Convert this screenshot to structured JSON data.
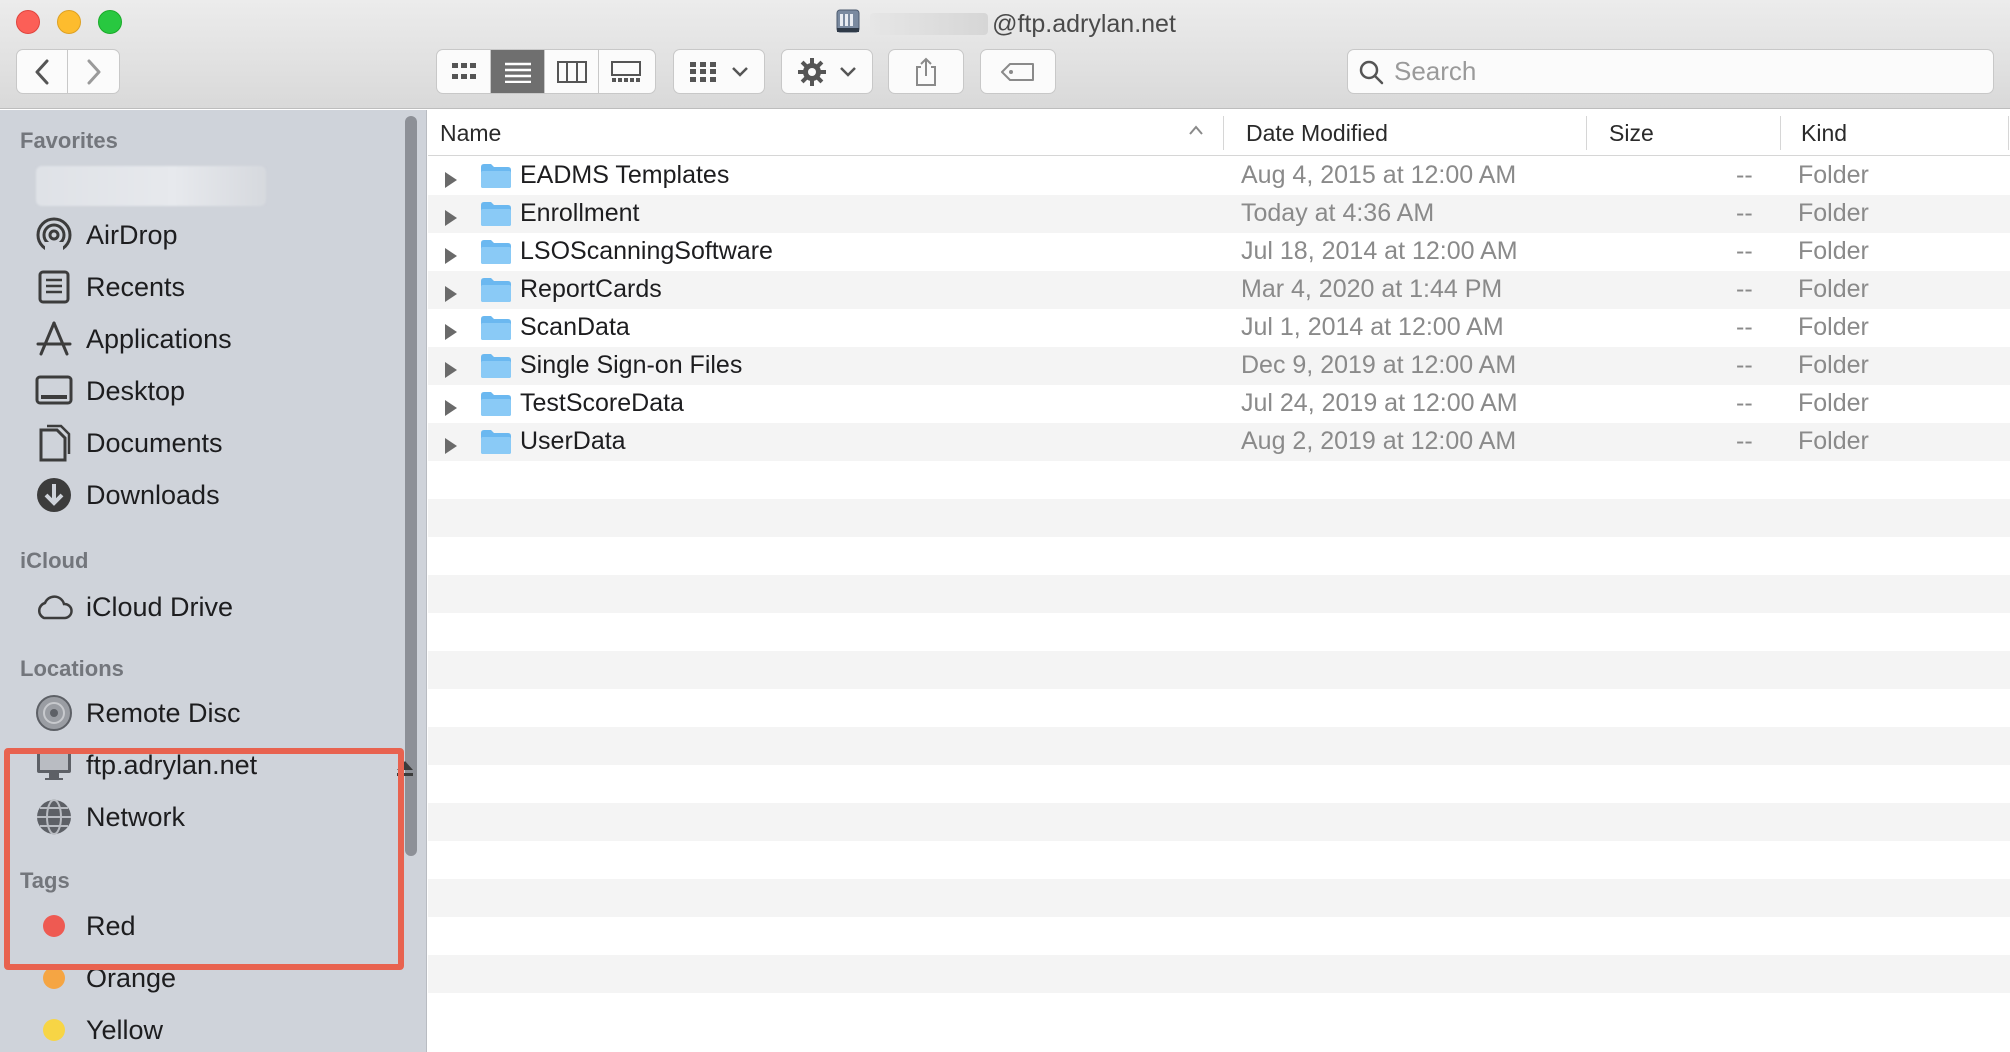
{
  "window": {
    "title": "@ftp.adrylan.net"
  },
  "toolbar": {
    "search_placeholder": "Search"
  },
  "sidebar": {
    "favorites_header": "Favorites",
    "favorites": [
      {
        "label": "AirDrop",
        "icon": "airdrop-icon"
      },
      {
        "label": "Recents",
        "icon": "recents-icon"
      },
      {
        "label": "Applications",
        "icon": "applications-icon"
      },
      {
        "label": "Desktop",
        "icon": "desktop-icon"
      },
      {
        "label": "Documents",
        "icon": "documents-icon"
      },
      {
        "label": "Downloads",
        "icon": "downloads-icon"
      }
    ],
    "icloud_header": "iCloud",
    "icloud": [
      {
        "label": "iCloud Drive",
        "icon": "cloud-icon"
      }
    ],
    "locations_header": "Locations",
    "locations": [
      {
        "label": "Remote Disc",
        "icon": "disc-icon"
      },
      {
        "label": "ftp.adrylan.net",
        "icon": "display-icon"
      },
      {
        "label": "Network",
        "icon": "globe-icon"
      }
    ],
    "tags_header": "Tags",
    "tags": [
      {
        "label": "Red",
        "color": "#ee5a52"
      },
      {
        "label": "Orange",
        "color": "#f5a543"
      },
      {
        "label": "Yellow",
        "color": "#f7d545"
      }
    ]
  },
  "columns": {
    "name": "Name",
    "date": "Date Modified",
    "size": "Size",
    "kind": "Kind"
  },
  "files": [
    {
      "name": "EADMS Templates",
      "date": "Aug 4, 2015 at 12:00 AM",
      "size": "--",
      "kind": "Folder"
    },
    {
      "name": "Enrollment",
      "date": "Today at 4:36 AM",
      "size": "--",
      "kind": "Folder"
    },
    {
      "name": "LSOScanningSoftware",
      "date": "Jul 18, 2014 at 12:00 AM",
      "size": "--",
      "kind": "Folder"
    },
    {
      "name": "ReportCards",
      "date": "Mar 4, 2020 at 1:44 PM",
      "size": "--",
      "kind": "Folder"
    },
    {
      "name": "ScanData",
      "date": "Jul 1, 2014 at 12:00 AM",
      "size": "--",
      "kind": "Folder"
    },
    {
      "name": "Single Sign-on Files",
      "date": "Dec 9, 2019 at 12:00 AM",
      "size": "--",
      "kind": "Folder"
    },
    {
      "name": "TestScoreData",
      "date": "Jul 24, 2019 at 12:00 AM",
      "size": "--",
      "kind": "Folder"
    },
    {
      "name": "UserData",
      "date": "Aug 2, 2019 at 12:00 AM",
      "size": "--",
      "kind": "Folder"
    }
  ],
  "colors": {
    "highlight": "#e8624f",
    "folder": "#6bb8f0",
    "sidebar_bg": "#cfd3da"
  }
}
